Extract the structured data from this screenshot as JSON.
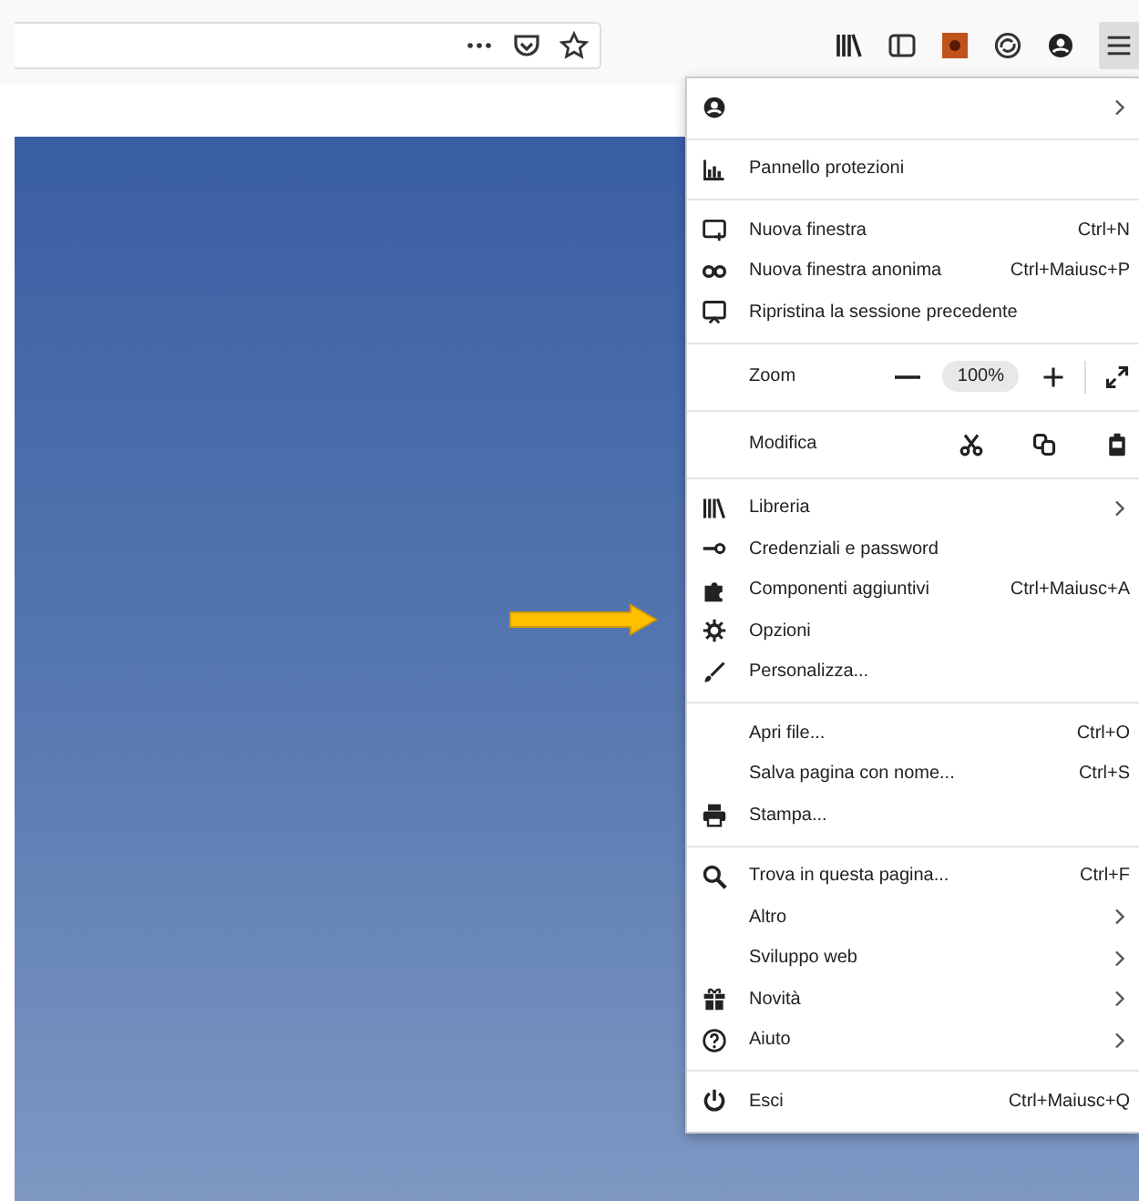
{
  "menu": {
    "sections": [
      {
        "items": [
          {
            "kind": "account",
            "submenu": true
          }
        ]
      },
      {
        "items": [
          {
            "kind": "item",
            "label": "Pannello protezioni",
            "submenu": false
          }
        ]
      },
      {
        "items": [
          {
            "kind": "item",
            "label": "Nuova finestra",
            "shortcut": "Ctrl+N",
            "submenu": false
          },
          {
            "kind": "item",
            "label": "Nuova finestra anonima",
            "shortcut": "Ctrl+Maiusc+P",
            "submenu": false
          },
          {
            "kind": "item",
            "label": "Ripristina la sessione precedente",
            "submenu": false
          }
        ]
      },
      {
        "items": [
          {
            "kind": "zoom",
            "label": "Zoom",
            "value": "100%"
          }
        ]
      },
      {
        "items": [
          {
            "kind": "edit",
            "label": "Modifica"
          }
        ]
      },
      {
        "items": [
          {
            "kind": "item",
            "label": "Libreria",
            "submenu": true
          },
          {
            "kind": "item",
            "label": "Credenziali e password",
            "submenu": false
          },
          {
            "kind": "item",
            "label": "Componenti aggiuntivi",
            "shortcut": "Ctrl+Maiusc+A",
            "submenu": false
          },
          {
            "kind": "item",
            "label": "Opzioni",
            "submenu": false
          },
          {
            "kind": "item",
            "label": "Personalizza...",
            "submenu": false
          }
        ]
      },
      {
        "items": [
          {
            "kind": "item",
            "label": "Apri file...",
            "shortcut": "Ctrl+O",
            "submenu": false
          },
          {
            "kind": "item",
            "label": "Salva pagina con nome...",
            "shortcut": "Ctrl+S",
            "submenu": false
          },
          {
            "kind": "item",
            "label": "Stampa...",
            "submenu": false
          }
        ]
      },
      {
        "items": [
          {
            "kind": "item",
            "label": "Trova in questa pagina...",
            "shortcut": "Ctrl+F",
            "submenu": false
          },
          {
            "kind": "item",
            "label": "Altro",
            "submenu": true
          },
          {
            "kind": "item",
            "label": "Sviluppo web",
            "submenu": true
          },
          {
            "kind": "item",
            "label": "Novità",
            "submenu": true
          },
          {
            "kind": "item",
            "label": "Aiuto",
            "submenu": true
          }
        ]
      },
      {
        "items": [
          {
            "kind": "item",
            "label": "Esci",
            "shortcut": "Ctrl+Maiusc+Q",
            "submenu": false
          }
        ]
      }
    ]
  }
}
